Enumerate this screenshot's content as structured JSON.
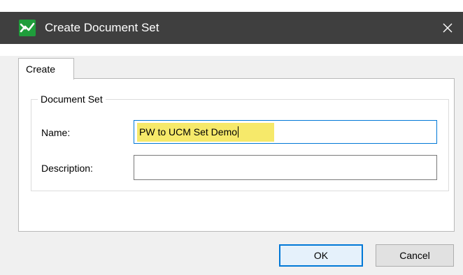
{
  "window": {
    "title": "Create Document Set",
    "app_icon": "app-logo-icon",
    "close_icon": "close-icon"
  },
  "tabs": [
    {
      "label": "Create",
      "selected": true
    }
  ],
  "group": {
    "legend": "Document Set"
  },
  "form": {
    "name_label": "Name:",
    "name_value": "PW to UCM Set Demo",
    "description_label": "Description:",
    "description_value": ""
  },
  "buttons": {
    "ok_label": "OK",
    "cancel_label": "Cancel"
  },
  "colors": {
    "titlebar": "#3f3f3f",
    "accent": "#0078d7",
    "highlight": "#f6e96a",
    "icon_green": "#1f9d3b"
  }
}
